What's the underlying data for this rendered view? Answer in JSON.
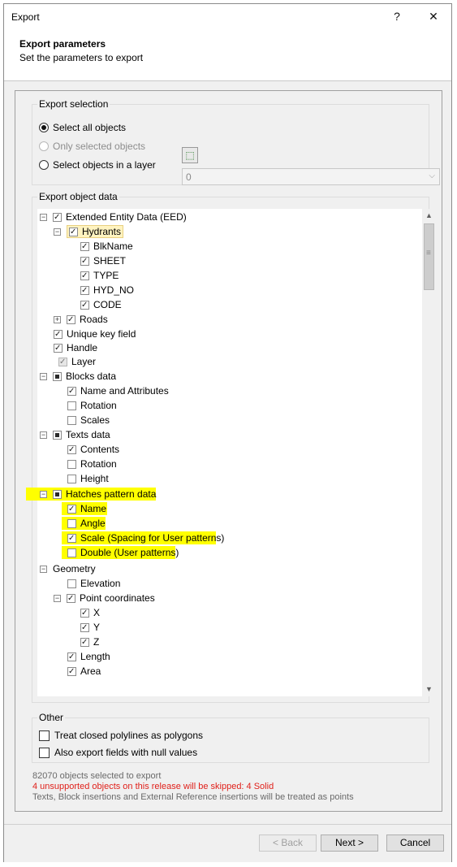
{
  "window": {
    "title": "Export",
    "help_label": "?",
    "close_label": "✕"
  },
  "header": {
    "title": "Export parameters",
    "subtitle": "Set the parameters to export"
  },
  "export_selection": {
    "legend": "Export selection",
    "select_all": "Select all objects",
    "only_selected": "Only selected objects",
    "in_layer": "Select objects in a layer",
    "layer_value": "0",
    "selected_option": "select_all"
  },
  "export_object_data": {
    "legend": "Export object data",
    "eed": "Extended Entity Data (EED)",
    "hydrants": "Hydrants",
    "hydrant_fields": [
      "BlkName",
      "SHEET",
      "TYPE",
      "HYD_NO",
      "CODE"
    ],
    "roads": "Roads",
    "unique_key": "Unique key field",
    "handle": "Handle",
    "layer": "Layer",
    "blocks": "Blocks data",
    "blocks_fields": [
      "Name and Attributes",
      "Rotation",
      "Scales"
    ],
    "texts": "Texts data",
    "texts_fields": [
      "Contents",
      "Rotation",
      "Height"
    ],
    "hatches": "Hatches pattern data",
    "hatches_fields": [
      "Name",
      "Angle",
      "Scale (Spacing for User patterns)",
      "Double (User patterns)"
    ],
    "geometry": "Geometry",
    "elevation": "Elevation",
    "point_coords": "Point coordinates",
    "coord_fields": [
      "X",
      "Y",
      "Z"
    ],
    "length": "Length",
    "area": "Area"
  },
  "other": {
    "legend": "Other",
    "closed_polylines": "Treat closed polylines as polygons",
    "null_values": "Also export fields with null values"
  },
  "status": {
    "selected_count": "82070 objects selected to export",
    "unsupported": "4 unsupported objects on this release will be skipped: 4 Solid",
    "points_note": "Texts, Block insertions and External Reference insertions will be treated as points"
  },
  "buttons": {
    "back": "< Back",
    "next": "Next >",
    "cancel": "Cancel"
  },
  "colors": {
    "highlight": "#ffff00",
    "warning": "#e0201a"
  }
}
